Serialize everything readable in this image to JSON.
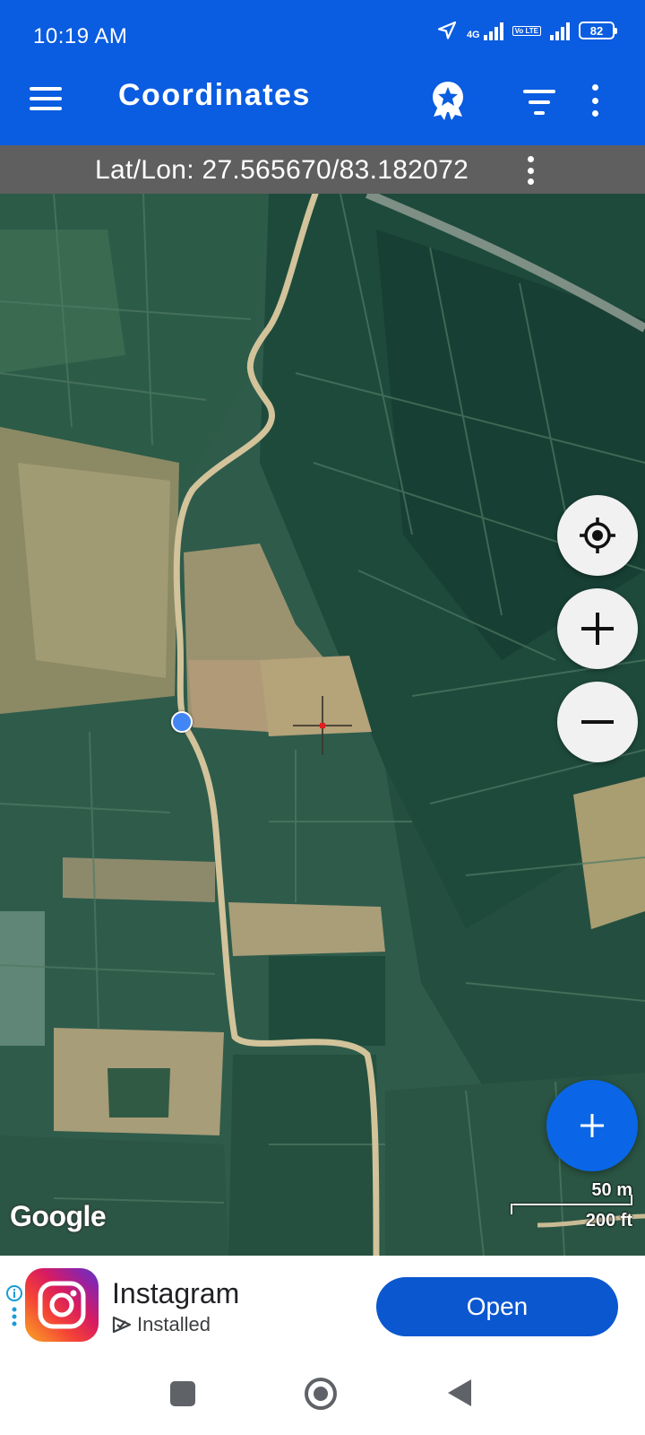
{
  "status_bar": {
    "time": "10:19 AM",
    "network_type": "4G",
    "volte": "Vo LTE",
    "battery": "82"
  },
  "app_bar": {
    "title": "Coordinates"
  },
  "coordinates": {
    "text": "Lat/Lon: 27.565670/83.182072"
  },
  "map": {
    "attribution": "Google",
    "scale_metric": "50 m",
    "scale_imperial": "200 ft"
  },
  "ad": {
    "app_name": "Instagram",
    "status": "Installed",
    "button_label": "Open"
  },
  "colors": {
    "primary": "#0a5ce0",
    "coord_bar": "#5f5f5f",
    "fab": "#0a66e6",
    "ad_button": "#0b57d0",
    "user_location": "#4285f4"
  },
  "icons": {
    "menu": "hamburger-icon",
    "badge": "award-badge-icon",
    "filter": "filter-icon",
    "more": "more-vert-icon",
    "locate": "my-location-icon",
    "zoom_in": "plus-icon",
    "zoom_out": "minus-icon",
    "add": "plus-icon"
  }
}
